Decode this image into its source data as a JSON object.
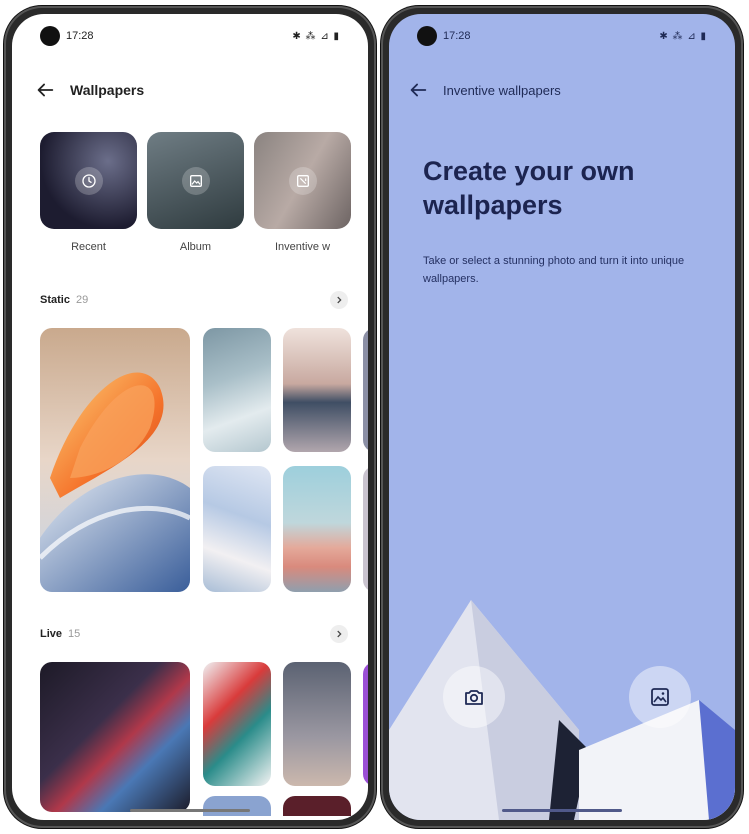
{
  "left_phone": {
    "status": {
      "time": "17:28",
      "icons": "✱ ⁂ ⊿ ▮"
    },
    "title": "Wallpapers",
    "categories": [
      {
        "label": "Recent",
        "icon": "clock-icon"
      },
      {
        "label": "Album",
        "icon": "image-icon"
      },
      {
        "label": "Inventive w",
        "icon": "inventive-icon"
      }
    ],
    "static_section": {
      "title": "Static",
      "count": "29"
    },
    "live_section": {
      "title": "Live",
      "count": "15"
    }
  },
  "right_phone": {
    "status": {
      "time": "17:28",
      "icons": "✱ ⁂ ⊿ ▮"
    },
    "title": "Inventive wallpapers",
    "headline": "Create your own wallpapers",
    "description": "Take or select a stunning photo and turn it into unique wallpapers.",
    "camera_button": "camera-icon",
    "gallery_button": "gallery-icon"
  },
  "colors": {
    "right_background": "#a2b4ea",
    "headline": "#1c2450"
  }
}
